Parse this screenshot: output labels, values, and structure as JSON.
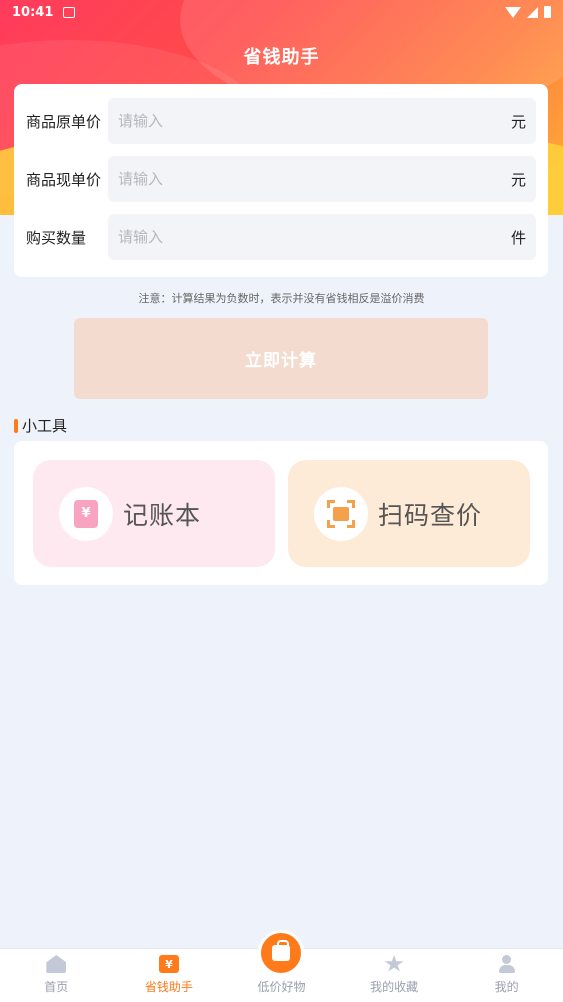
{
  "status_bar": {
    "time": "10:41"
  },
  "header": {
    "title": "省钱助手"
  },
  "form": {
    "fields": [
      {
        "label": "商品原单价",
        "placeholder": "请输入",
        "value": "",
        "unit": "元"
      },
      {
        "label": "商品现单价",
        "placeholder": "请输入",
        "value": "",
        "unit": "元"
      },
      {
        "label": "购买数量",
        "placeholder": "请输入",
        "value": "",
        "unit": "件"
      }
    ],
    "note": "注意：计算结果为负数时，表示并没有省钱相反是溢价消费",
    "submit_label": "立即计算"
  },
  "tools": {
    "section_title": "小工具",
    "items": [
      {
        "label": "记账本",
        "icon": "ledger-icon",
        "bg": "#fde9ef"
      },
      {
        "label": "扫码查价",
        "icon": "scan-icon",
        "bg": "#fdebd8"
      }
    ]
  },
  "tab_bar": {
    "active_color": "#ff7a1a",
    "items": [
      {
        "label": "首页",
        "icon": "home-icon"
      },
      {
        "label": "省钱助手",
        "icon": "money-icon",
        "active": true
      },
      {
        "label": "低价好物",
        "icon": "shopping-bag-icon"
      },
      {
        "label": "我的收藏",
        "icon": "star-icon"
      },
      {
        "label": "我的",
        "icon": "user-icon"
      }
    ]
  }
}
